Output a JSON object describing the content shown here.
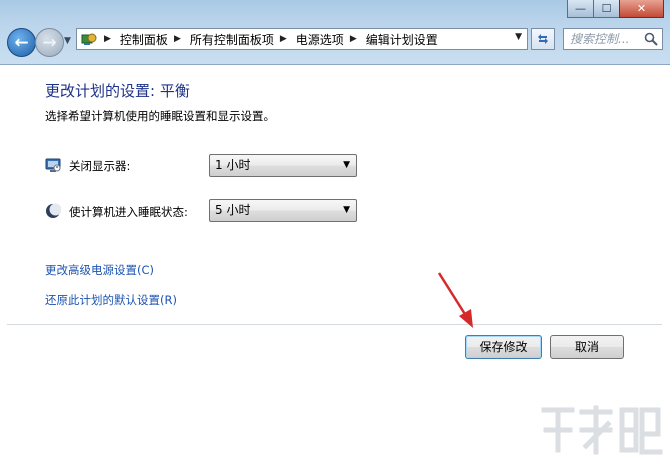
{
  "window": {
    "minimize_glyph": "—",
    "maximize_glyph": "☐",
    "close_glyph": "✕"
  },
  "address_bar": {
    "breadcrumbs": [
      "控制面板",
      "所有控制面板项",
      "电源选项",
      "编辑计划设置"
    ],
    "search_placeholder": "搜索控制..."
  },
  "page": {
    "title": "更改计划的设置: 平衡",
    "subtitle": "选择希望计算机使用的睡眠设置和显示设置。",
    "settings": [
      {
        "label": "关闭显示器:",
        "value": "1 小时",
        "icon": "monitor-icon"
      },
      {
        "label": "使计算机进入睡眠状态:",
        "value": "5 小时",
        "icon": "sleep-moon-icon"
      }
    ],
    "links": {
      "advanced": "更改高级电源设置(C)",
      "restore": "还原此计划的默认设置(R)"
    },
    "buttons": {
      "save": "保存修改",
      "cancel": "取消"
    }
  },
  "colors": {
    "title": "#1e3287",
    "link": "#1d54b1",
    "annotation_arrow": "#d42a2a"
  }
}
